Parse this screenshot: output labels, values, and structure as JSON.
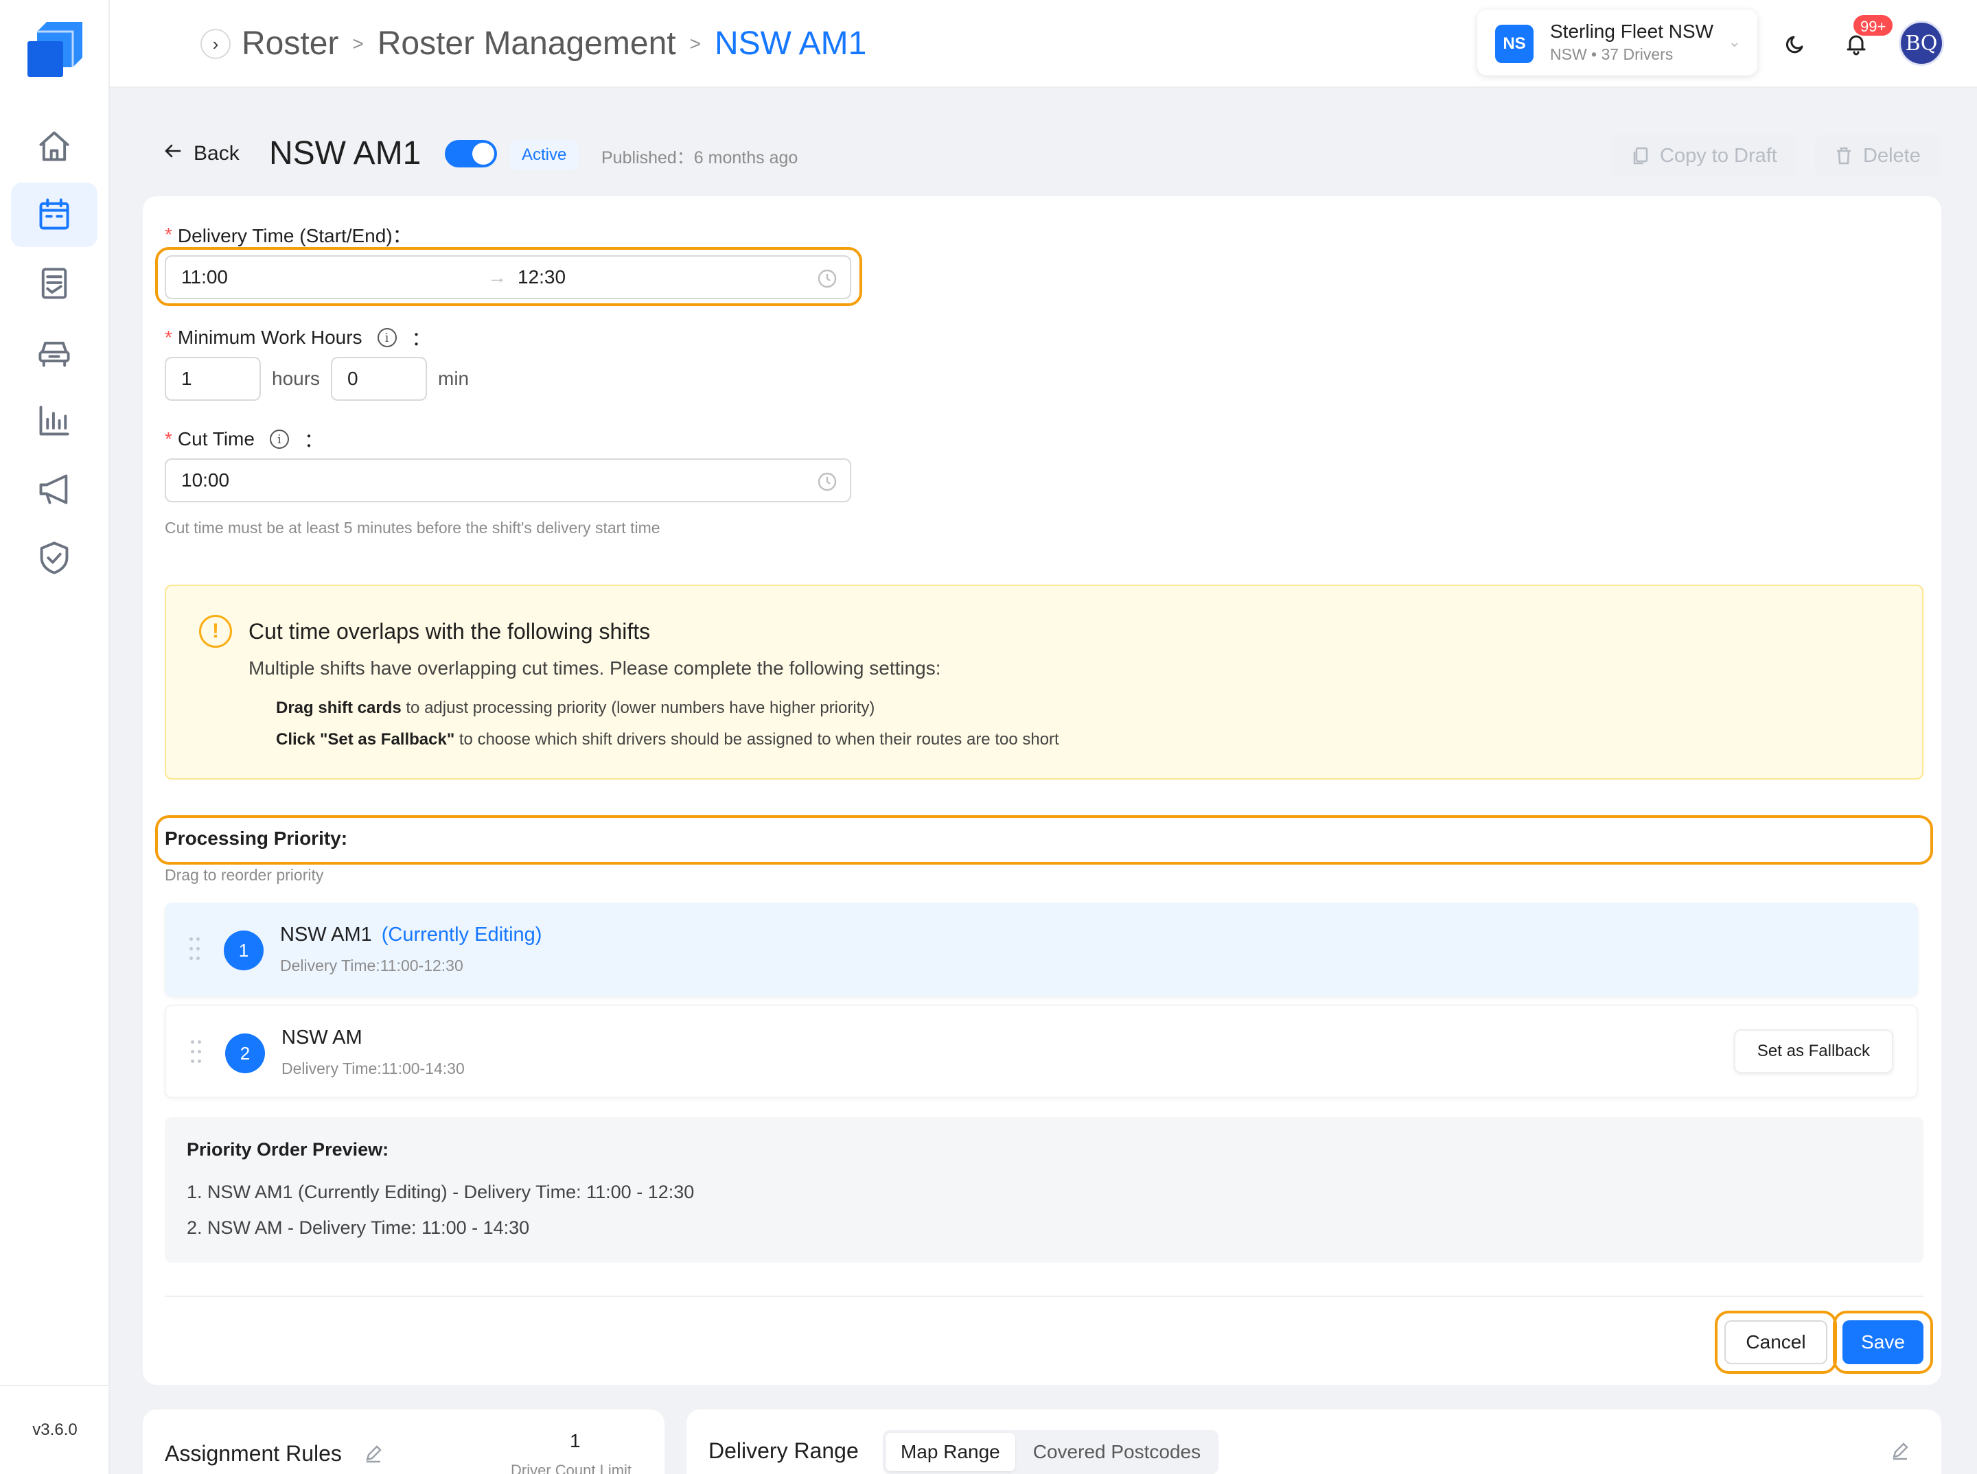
{
  "sidebar": {
    "items": [
      {
        "icon": "home-icon"
      },
      {
        "icon": "calendar-icon",
        "active": true
      },
      {
        "icon": "document-icon"
      },
      {
        "icon": "car-icon"
      },
      {
        "icon": "bar-chart-icon"
      },
      {
        "icon": "megaphone-icon"
      },
      {
        "icon": "shield-check-icon"
      }
    ],
    "version": "v3.6.0"
  },
  "header": {
    "breadcrumb": [
      "Roster",
      "Roster Management",
      "NSW AM1"
    ],
    "fleet": {
      "initials": "NS",
      "name": "Sterling Fleet NSW",
      "sub": "NSW • 37 Drivers"
    },
    "notifications_badge": "99+",
    "user_initials": "BQ"
  },
  "titlebar": {
    "back": "Back",
    "title": "NSW AM1",
    "status": "Active",
    "published": "Published：6 months ago",
    "copy_to_draft": "Copy to Draft",
    "delete": "Delete"
  },
  "form": {
    "delivery_time_label": "Delivery Time (Start/End)：",
    "delivery_start": "11:00",
    "delivery_end": "12:30",
    "min_work_label": "Minimum Work Hours",
    "min_hours": "1",
    "hours_unit": "hours",
    "min_minutes": "0",
    "min_unit": "min",
    "cut_time_label": "Cut Time",
    "cut_time": "10:00",
    "cut_time_hint": "Cut time must be at least 5 minutes before the shift's delivery start time",
    "colon": "："
  },
  "warning": {
    "title": "Cut time overlaps with the following shifts",
    "desc": "Multiple shifts have overlapping cut times. Please complete the following settings:",
    "item1_bold": "Drag shift cards",
    "item1_rest": " to adjust processing priority (lower numbers have higher priority)",
    "item2_bold": "Click \"Set as Fallback\"",
    "item2_rest": " to choose which shift drivers should be assigned to when their routes are too short"
  },
  "priority": {
    "title": "Processing Priority:",
    "hint": "Drag to reorder priority",
    "shifts": [
      {
        "num": "1",
        "name": "NSW AM1",
        "tag": "(Currently Editing)",
        "time": "Delivery Time:11:00-12:30"
      },
      {
        "num": "2",
        "name": "NSW AM",
        "time": "Delivery Time:11:00-14:30",
        "action": "Set as Fallback"
      }
    ],
    "preview_title": "Priority Order Preview:",
    "preview_items": [
      "1. NSW AM1 (Currently Editing) - Delivery Time: 11:00 - 12:30",
      "2. NSW AM - Delivery Time: 11:00 - 14:30"
    ]
  },
  "actions": {
    "cancel": "Cancel",
    "save": "Save"
  },
  "bottom": {
    "assignment_title": "Assignment Rules",
    "driver_count_value": "1",
    "driver_count_label": "Driver Count Limit",
    "delivery_range_title": "Delivery Range",
    "tabs": [
      "Map Range",
      "Covered Postcodes"
    ]
  },
  "colors": {
    "accent": "#1677ff",
    "highlight": "#f59e0b",
    "warning_bg": "#fffbe6"
  }
}
